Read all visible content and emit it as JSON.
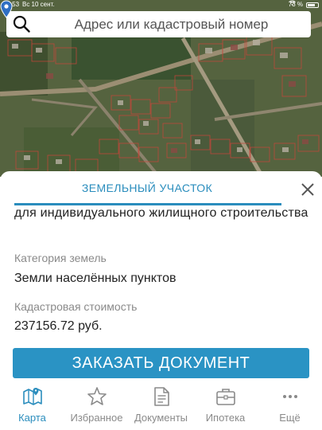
{
  "status_bar": {
    "time": "22:53",
    "date": "Вс 10 сент.",
    "battery": "73 %"
  },
  "search": {
    "placeholder": "Адрес или кадастровый номер"
  },
  "sheet": {
    "title": "ЗЕМЕЛЬНЫЙ УЧАСТОК",
    "purpose": "для индивидуального жилищного строительства",
    "category_label": "Категория земель",
    "category_value": "Земли населённых пунктов",
    "cost_label": "Кадастровая стоимость",
    "cost_value": "237156.72 руб.",
    "order_button": "ЗАКАЗАТЬ ДОКУМЕНТ"
  },
  "tabs": [
    {
      "label": "Карта",
      "icon": "map-icon",
      "active": true
    },
    {
      "label": "Избранное",
      "icon": "star-icon",
      "active": false
    },
    {
      "label": "Документы",
      "icon": "document-icon",
      "active": false
    },
    {
      "label": "Ипотека",
      "icon": "briefcase-icon",
      "active": false
    },
    {
      "label": "Ещё",
      "icon": "more-icon",
      "active": false
    }
  ],
  "colors": {
    "accent": "#2a8dbd",
    "button": "#2a93c4"
  }
}
